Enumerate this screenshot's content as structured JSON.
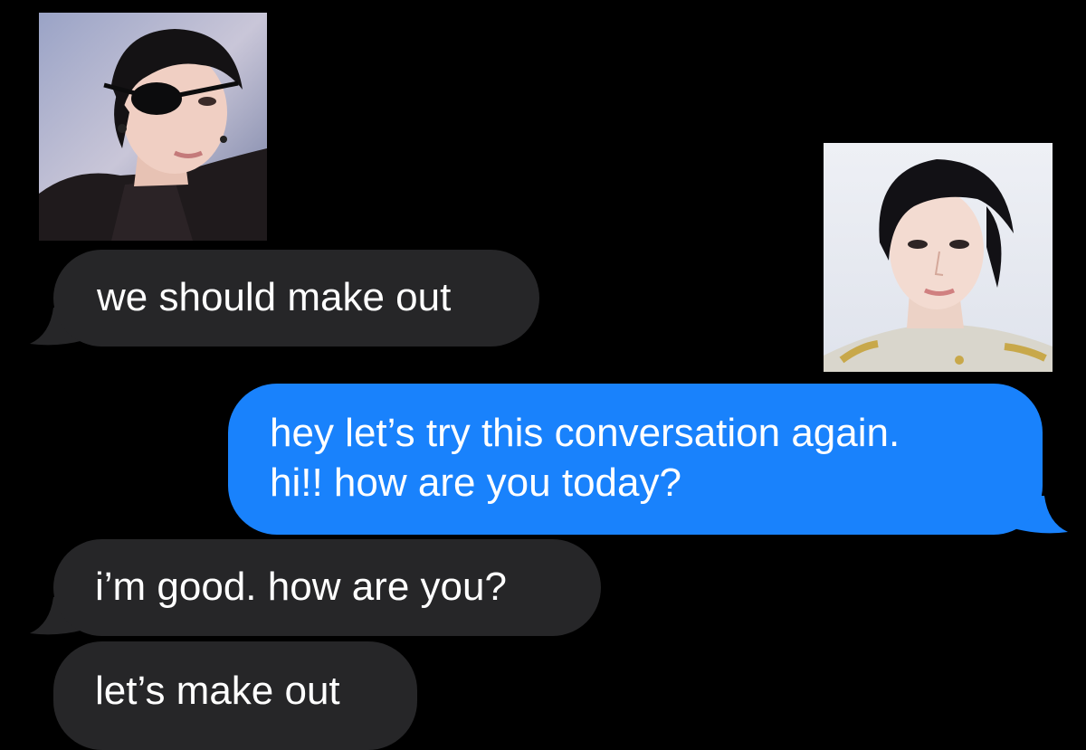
{
  "conversation": {
    "avatars": [
      {
        "icon": "contact-photo-eyepatch"
      },
      {
        "icon": "contact-photo-portrait"
      }
    ],
    "messages": [
      {
        "side": "received",
        "text": "we should make out"
      },
      {
        "side": "sent",
        "lines": [
          "hey let’s try this conversation again.",
          "hi!! how are you today?"
        ]
      },
      {
        "side": "received",
        "text": "i’m good. how are you?"
      },
      {
        "side": "received",
        "text": "let’s make out"
      }
    ]
  },
  "colors": {
    "background": "#000000",
    "received_bubble": "#262628",
    "sent_bubble": "#1982fc",
    "text": "#ffffff"
  }
}
